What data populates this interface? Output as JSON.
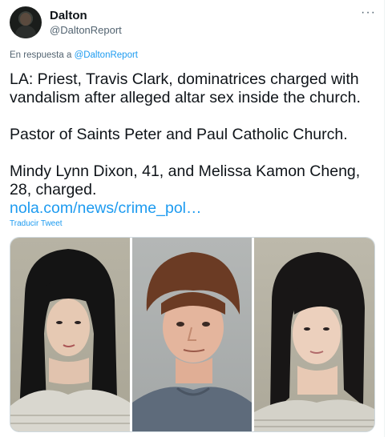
{
  "author": {
    "name": "Dalton",
    "handle": "@DaltonReport"
  },
  "menu": {
    "more_icon": "···"
  },
  "reply": {
    "prefix": "En respuesta a",
    "mention": "@DaltonReport"
  },
  "tweet": {
    "paragraphs": [
      "LA: Priest, Travis Clark, dominatrices charged with vandalism after alleged altar sex inside the church.",
      "Pastor of Saints Peter and Paul Catholic Church.",
      "Mindy Lynn Dixon, 41, and Melissa Kamon Cheng, 28, charged."
    ],
    "link": "nola.com/news/crime_pol…"
  },
  "translate_label": "Traducir Tweet",
  "media": {
    "photos": [
      "mugshot-woman-left",
      "mugshot-man-center",
      "mugshot-woman-right"
    ]
  },
  "colors": {
    "accent": "#1d9bf0",
    "text": "#0f1419",
    "secondary": "#536471"
  }
}
